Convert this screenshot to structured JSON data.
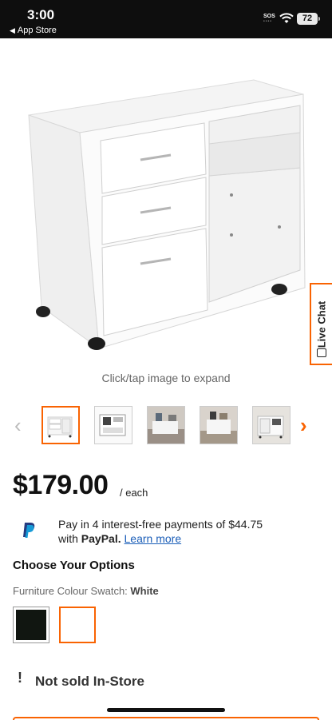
{
  "status_bar": {
    "time": "3:00",
    "back_label": "App Store",
    "sos": "SOS",
    "battery": "72"
  },
  "product": {
    "image_hint": "Click/tap image to expand",
    "live_chat_label": "Live Chat",
    "thumbnails": [
      "thumb-1",
      "thumb-2",
      "thumb-3",
      "thumb-4",
      "thumb-5"
    ],
    "active_thumbnail_index": 0,
    "price": "$179.00",
    "price_unit": "/ each"
  },
  "paypal": {
    "line1": "Pay in 4 interest-free payments of $44.75",
    "line2_prefix": "with",
    "brand": "PayPal.",
    "learn_more": "Learn more"
  },
  "options": {
    "title": "Choose Your Options",
    "swatch_label": "Furniture Colour Swatch:",
    "swatch_value": "White",
    "swatches": [
      {
        "name": "Black",
        "color": "#111611"
      },
      {
        "name": "White",
        "color": "#ffffff"
      }
    ],
    "selected_swatch": "White"
  },
  "availability": {
    "icon": "exclamation-icon",
    "text": "Not sold In-Store"
  },
  "colors": {
    "accent": "#f96302",
    "link": "#1b5eb8"
  }
}
